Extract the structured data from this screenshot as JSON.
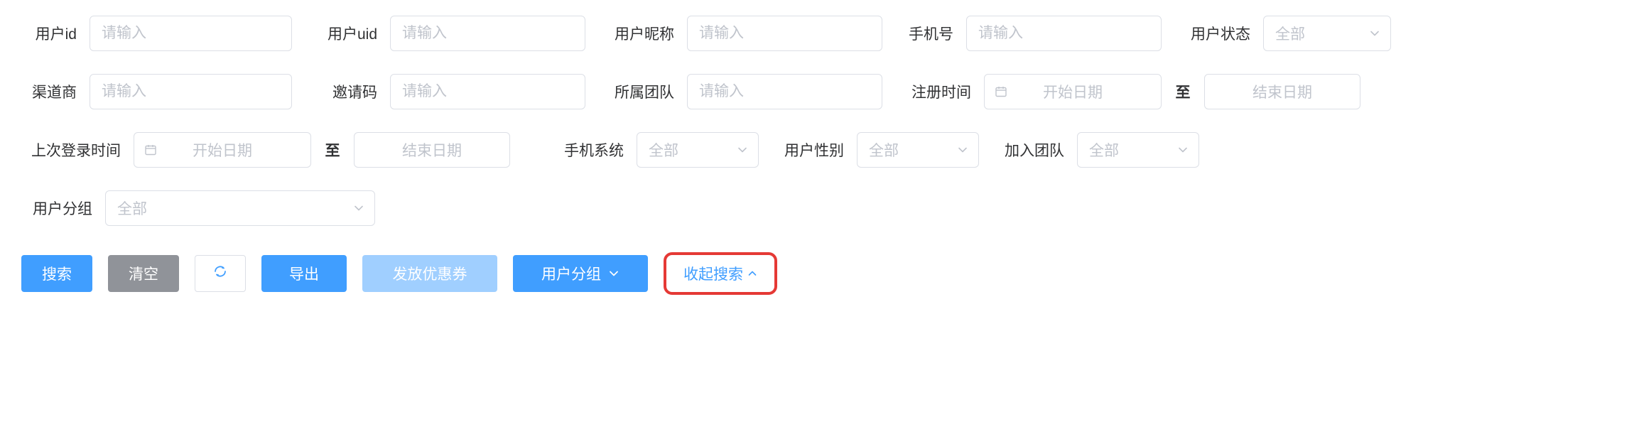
{
  "row1": {
    "user_id": {
      "label": "用户id",
      "placeholder": "请输入"
    },
    "user_uid": {
      "label": "用户uid",
      "placeholder": "请输入"
    },
    "nickname": {
      "label": "用户昵称",
      "placeholder": "请输入"
    },
    "phone": {
      "label": "手机号",
      "placeholder": "请输入"
    },
    "status": {
      "label": "用户状态",
      "placeholder": "全部"
    }
  },
  "row2": {
    "channel": {
      "label": "渠道商",
      "placeholder": "请输入"
    },
    "invite_code": {
      "label": "邀请码",
      "placeholder": "请输入"
    },
    "team": {
      "label": "所属团队",
      "placeholder": "请输入"
    },
    "reg_time": {
      "label": "注册时间",
      "start_placeholder": "开始日期",
      "sep": "至",
      "end_placeholder": "结束日期"
    }
  },
  "row3": {
    "last_login": {
      "label": "上次登录时间",
      "start_placeholder": "开始日期",
      "sep": "至",
      "end_placeholder": "结束日期"
    },
    "phone_os": {
      "label": "手机系统",
      "placeholder": "全部"
    },
    "gender": {
      "label": "用户性别",
      "placeholder": "全部"
    },
    "join_team": {
      "label": "加入团队",
      "placeholder": "全部"
    }
  },
  "row4": {
    "user_group": {
      "label": "用户分组",
      "placeholder": "全部"
    }
  },
  "buttons": {
    "search": "搜索",
    "clear": "清空",
    "export": "导出",
    "coupon": "发放优惠券",
    "group": "用户分组",
    "collapse": "收起搜索"
  }
}
